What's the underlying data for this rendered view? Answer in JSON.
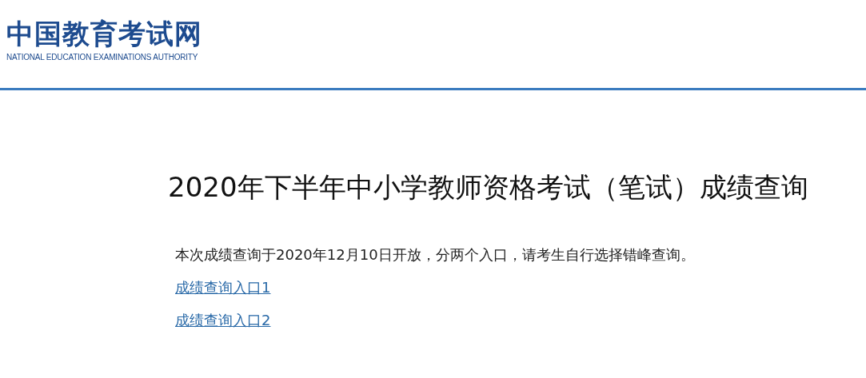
{
  "header": {
    "logo_title": "中国教育考试网",
    "logo_subtitle": "NATIONAL EDUCATION EXAMINATIONS AUTHORITY"
  },
  "page_title": "2020年下半年中小学教师资格考试（笔试）成绩查询",
  "notice": "本次成绩查询于2020年12月10日开放，分两个入口，请考生自行选择错峰查询。",
  "links": [
    "成绩查询入口1",
    "成绩查询入口2"
  ]
}
